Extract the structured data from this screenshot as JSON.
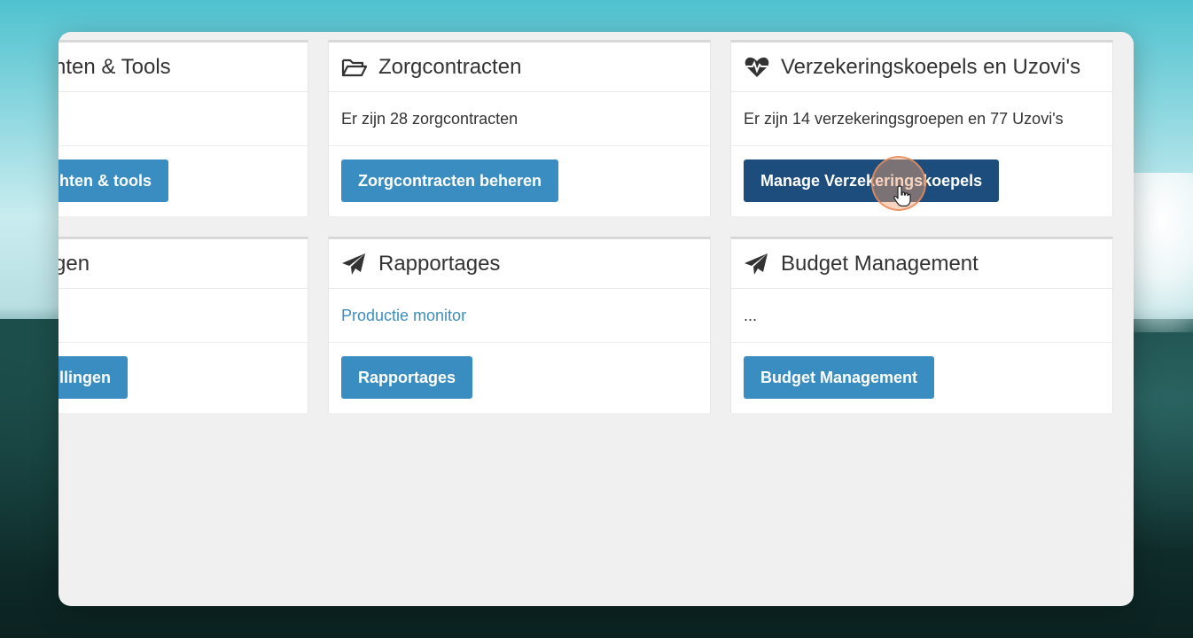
{
  "cards": {
    "tools": {
      "title": "nten & Tools",
      "button_label": "hten & tools"
    },
    "zorgcontracten": {
      "title": "Zorgcontracten",
      "body": "Er zijn 28 zorgcontracten",
      "button_label": "Zorgcontracten beheren"
    },
    "verzekeringskoepels": {
      "title": "Verzekeringskoepels en Uzovi's",
      "body": "Er zijn 14 verzekeringsgroepen en 77 Uzovi's",
      "button_label": "Manage Verzekeringskoepels"
    },
    "instellingen": {
      "title": "gen",
      "button_label": "llingen"
    },
    "rapportages": {
      "title": "Rapportages",
      "link": "Productie monitor",
      "button_label": "Rapportages"
    },
    "budget": {
      "title": "Budget Management",
      "body": "...",
      "button_label": "Budget Management"
    }
  },
  "icons": {
    "zorgcontracten": "folder-open-icon",
    "verzekeringskoepels": "heartbeat-icon",
    "rapportages": "paper-plane-icon",
    "budget": "paper-plane-icon",
    "cursor": "hand-pointer-icon"
  },
  "colors": {
    "button": "#3a8dc0",
    "button_active": "#1c4d7c",
    "link": "#3e8ebb"
  }
}
